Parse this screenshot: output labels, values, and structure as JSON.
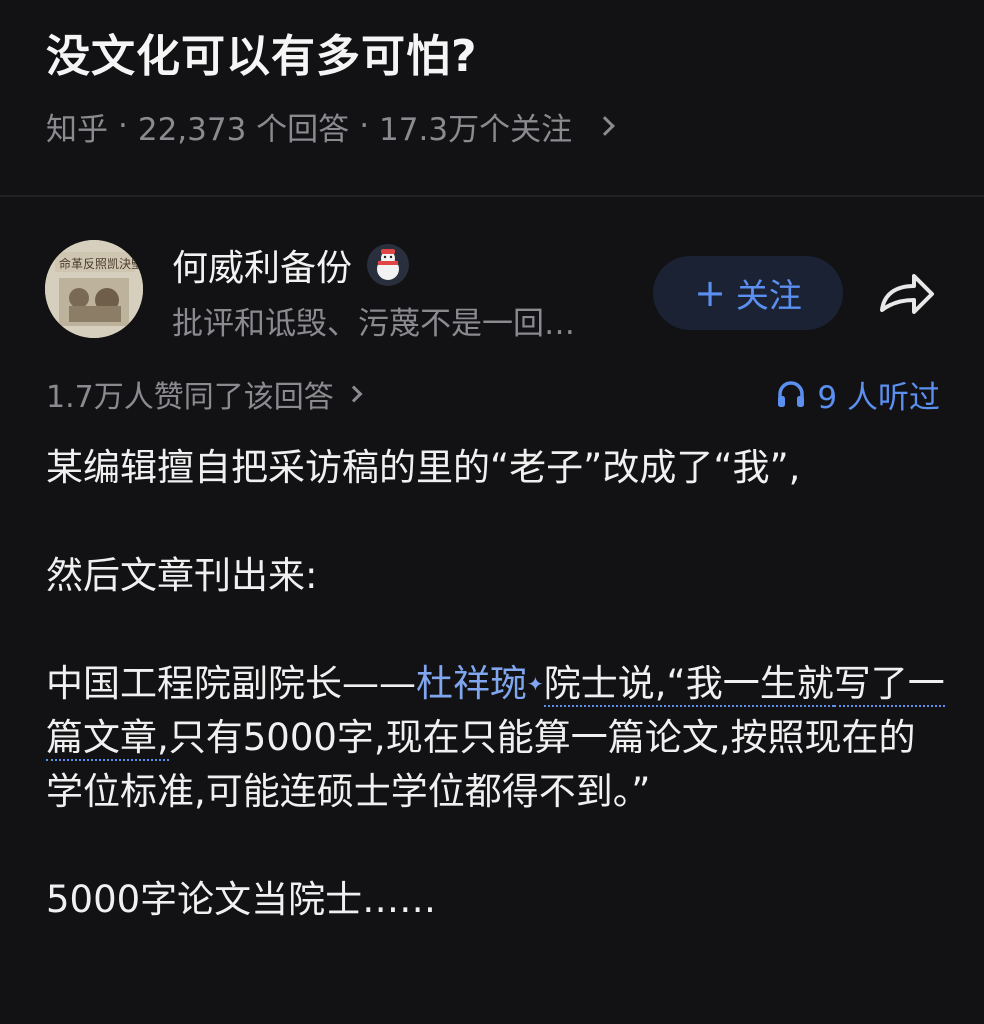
{
  "question": {
    "title": "没文化可以有多可怕?",
    "source": "知乎",
    "answers": "22,373 个回答",
    "followers": "17.3万个关注"
  },
  "author": {
    "name": "何威利备份",
    "bio": "批评和诋毁、污蔑不是一回…",
    "follow_label": "关注",
    "avatar_text": "命革反照凯決堅"
  },
  "answer": {
    "approvals": "1.7万人赞同了该回答",
    "listens": "9 人听过",
    "p1": "某编辑擅自把采访稿的里的“老子”改成了“我”,",
    "p2": "然后文章刊出来:",
    "p3_prefix": "中国工程院副院长——",
    "p3_link": "杜祥琬",
    "p3_quote_a": "院士说,“我一生就",
    "p3_quote_b": "写了一篇文章,",
    "p3_rest": "只有5000字,现在只能算一篇论文,按照现在的学位标准,可能连硕士学位都得不到。”",
    "p4": "5000字论文当院士……"
  },
  "icons": {
    "share": "share-arrow-icon",
    "listen": "headphones-icon",
    "badge": "snowman-badge-icon",
    "chevron": "chevron-right-icon"
  },
  "colors": {
    "background": "#121214",
    "accent": "#5b8ff0",
    "link": "#7fa6ee",
    "muted": "#8a8a8f"
  }
}
